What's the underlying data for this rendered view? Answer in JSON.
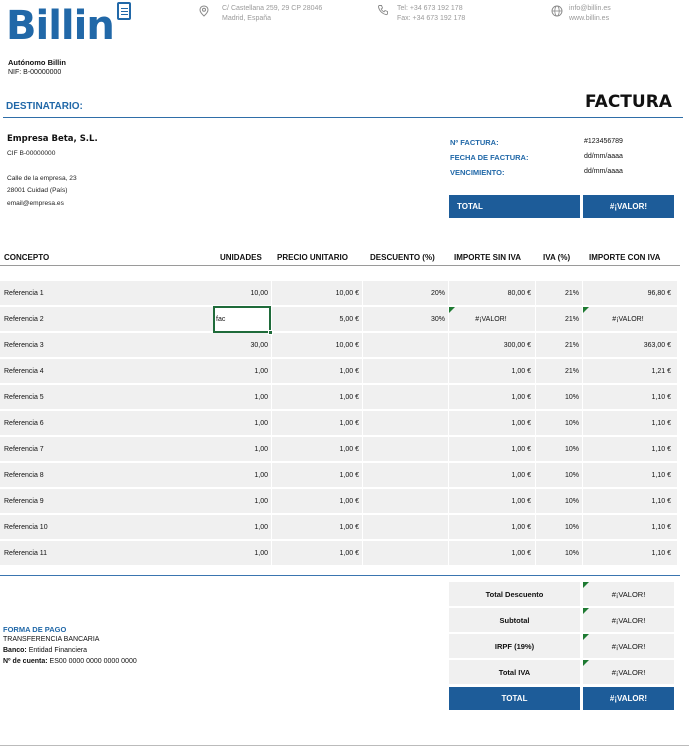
{
  "header": {
    "logo_text": "Billin",
    "address": [
      "C/ Castellana 259, 29 CP 28046",
      "Madrid, España"
    ],
    "phone": [
      "Tel: +34 673 192 178",
      "Fax: +34 673 192 178"
    ],
    "web": [
      "info@billin.es",
      "www.billin.es"
    ]
  },
  "issuer": {
    "name": "Autónomo Billin",
    "nif": "NIF: B-00000000"
  },
  "sections": {
    "destinatario": "DESTINATARIO:",
    "factura": "FACTURA"
  },
  "client": {
    "name": "Empresa Beta, S.L.",
    "cif": "CIF B-00000000",
    "street": "Calle de la empresa, 23",
    "city": "28001 Cuidad (País)",
    "email": "email@empresa.es"
  },
  "invoice": {
    "number_label": "Nº FACTURA:",
    "number_value": "#123456789",
    "date_label": "FECHA DE FACTURA:",
    "date_value": "dd/mm/aaaa",
    "due_label": "VENCIMIENTO:",
    "due_value": "dd/mm/aaaa",
    "total_label": "TOTAL",
    "total_value": "#¡VALOR!"
  },
  "table": {
    "headers": [
      "CONCEPTO",
      "UNIDADES",
      "PRECIO UNITARIO",
      "DESCUENTO (%)",
      "IMPORTE SIN IVA",
      "IVA (%)",
      "IMPORTE CON IVA"
    ],
    "rows": [
      [
        "Referencia 1",
        "10,00",
        "10,00 €",
        "20%",
        "80,00 €",
        "21%",
        "96,80 €"
      ],
      [
        "Referencia 2",
        "fac",
        "5,00 €",
        "30%",
        "#¡VALOR!",
        "21%",
        "#¡VALOR!"
      ],
      [
        "Referencia 3",
        "30,00",
        "10,00 €",
        "",
        "300,00 €",
        "21%",
        "363,00 €"
      ],
      [
        "Referencia 4",
        "1,00",
        "1,00 €",
        "",
        "1,00 €",
        "21%",
        "1,21 €"
      ],
      [
        "Referencia 5",
        "1,00",
        "1,00 €",
        "",
        "1,00 €",
        "10%",
        "1,10 €"
      ],
      [
        "Referencia 6",
        "1,00",
        "1,00 €",
        "",
        "1,00 €",
        "10%",
        "1,10 €"
      ],
      [
        "Referencia 7",
        "1,00",
        "1,00 €",
        "",
        "1,00 €",
        "10%",
        "1,10 €"
      ],
      [
        "Referencia 8",
        "1,00",
        "1,00 €",
        "",
        "1,00 €",
        "10%",
        "1,10 €"
      ],
      [
        "Referencia 9",
        "1,00",
        "1,00 €",
        "",
        "1,00 €",
        "10%",
        "1,10 €"
      ],
      [
        "Referencia 10",
        "1,00",
        "1,00 €",
        "",
        "1,00 €",
        "10%",
        "1,10 €"
      ],
      [
        "Referencia 11",
        "1,00",
        "1,00 €",
        "",
        "1,00 €",
        "10%",
        "1,10 €"
      ]
    ]
  },
  "totals": {
    "rows": [
      {
        "label": "Total Descuento",
        "value": "#¡VALOR!"
      },
      {
        "label": "Subtotal",
        "value": "#¡VALOR!"
      },
      {
        "label": "IRPF (19%)",
        "value": "#¡VALOR!"
      },
      {
        "label": "Total IVA",
        "value": "#¡VALOR!"
      }
    ],
    "grand_label": "TOTAL",
    "grand_value": "#¡VALOR!"
  },
  "payment": {
    "title": "FORMA DE PAGO",
    "method": "TRANSFERENCIA BANCARIA",
    "bank_label": "Banco:",
    "bank_value": "Entidad Financiera",
    "account_label": "Nº de cuenta:",
    "account_value": "ES00 0000 0000 0000 0000"
  },
  "colors": {
    "brand_blue": "#1d5c99",
    "error_triangle": "#1e7a32"
  }
}
